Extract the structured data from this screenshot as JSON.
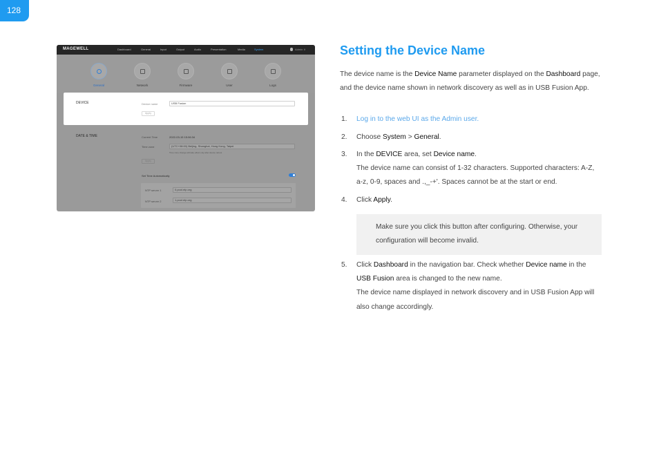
{
  "page_number": "128",
  "screenshot": {
    "brand": "MAGEWELL",
    "nav": [
      "Dashboard",
      "General",
      "Input",
      "Output",
      "Audio",
      "Presentation",
      "Media",
      "System"
    ],
    "nav_active": "System",
    "user": "Admin ∨",
    "tabs": [
      "General",
      "Network",
      "Firmware",
      "User",
      "Logs"
    ],
    "tab_active": "General",
    "device_section": "DEVICE",
    "device_name_label": "Device name",
    "device_name_value": "USB Fusion",
    "apply": "Apply",
    "datetime_section": "DATE & TIME",
    "current_time_label": "Current Time",
    "current_time_value": "2022-03-15 15:06:34",
    "time_zone_label": "Time zone",
    "time_zone_value": "(UTC+08:00) Beijing, Shanghai, Hong Kong, Taipei",
    "time_zone_hint": "Time zone change will take effect only after device reboot",
    "set_auto_label": "Set Time Automatically",
    "ntp1_label": "NTP server 1",
    "ntp1_value": "0.pool.ntp.org",
    "ntp2_label": "NTP server 2",
    "ntp2_value": "1.pool.ntp.org"
  },
  "heading": "Setting the Device Name",
  "intro": {
    "t1": "The device name is the ",
    "b1": "Device Name",
    "t2": " parameter displayed on the ",
    "b2": "Dashboard",
    "t3": " page, and the device name shown in network discovery as well as in USB Fusion App."
  },
  "steps": {
    "s1_num": "1.",
    "s1_link": "Log in to the web UI as the Admin user.",
    "s2_num": "2.",
    "s2_t1": "Choose ",
    "s2_b1": "System",
    "s2_t2": " > ",
    "s2_b2": "General",
    "s2_t3": ".",
    "s3_num": "3.",
    "s3_t1": "In the ",
    "s3_b1": "DEVICE",
    "s3_t2": " area, set ",
    "s3_b2": "Device name",
    "s3_t3": ".",
    "s3_detail": "The device name can consist of 1-32 characters. Supported characters: A-Z, a-z, 0-9, spaces and .,_-+'. Spaces cannot be at the start or end.",
    "s4_num": "4.",
    "s4_t1": "Click ",
    "s4_b1": "Apply",
    "s4_t2": ".",
    "note": "Make sure you click this button after configuring. Otherwise, your configuration will become invalid.",
    "s5_num": "5.",
    "s5_t1": "Click ",
    "s5_b1": "Dashboard",
    "s5_t2": " in the navigation bar. Check whether ",
    "s5_b2": "Device name",
    "s5_t3": " in the ",
    "s5_b3": "USB Fusion",
    "s5_t4": " area is changed to the new name.",
    "s5_detail": "The device name displayed in network discovery and in USB Fusion App will also change accordingly."
  }
}
